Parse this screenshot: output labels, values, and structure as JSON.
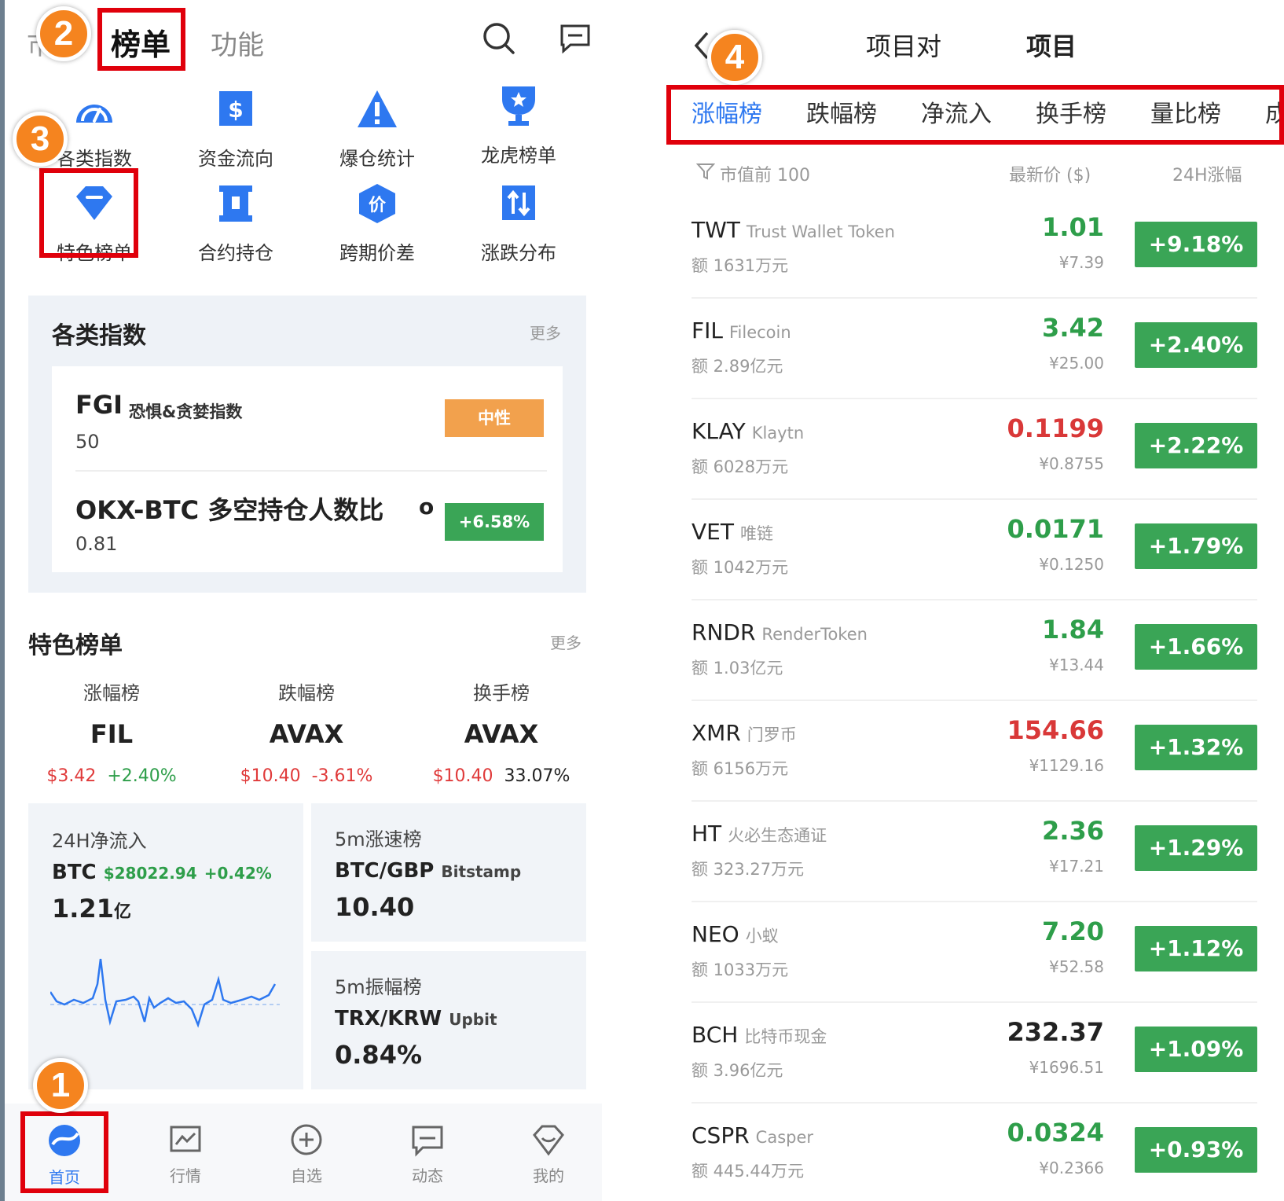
{
  "left": {
    "top_tabs": {
      "partial": "市",
      "rank": "榜单",
      "functions": "功能"
    },
    "functions": [
      {
        "label": "各类指数",
        "icon": "gauge-icon"
      },
      {
        "label": "资金流向",
        "icon": "dollar-icon"
      },
      {
        "label": "爆仓统计",
        "icon": "warning-icon"
      },
      {
        "label": "龙虎榜单",
        "icon": "trophy-icon"
      },
      {
        "label": "特色榜单",
        "icon": "diamond-icon"
      },
      {
        "label": "合约持仓",
        "icon": "contract-icon"
      },
      {
        "label": "跨期价差",
        "icon": "price-icon"
      },
      {
        "label": "涨跌分布",
        "icon": "updown-icon"
      }
    ],
    "index_section": {
      "title": "各类指数",
      "more": "更多",
      "fgi": {
        "code": "FGI",
        "name": "恐惧&贪婪指数",
        "value": "50",
        "badge": "中性",
        "badge_color": "#f2a14d"
      },
      "okx": {
        "name": "OKX-BTC 多空持仓人数比",
        "suffix": "o",
        "value": "0.81",
        "badge": "+6.58%",
        "badge_color": "#3aa556"
      }
    },
    "feature_section": {
      "title": "特色榜单",
      "more": "更多",
      "columns": [
        {
          "cat": "涨幅榜",
          "sym": "FIL",
          "price": "$3.42",
          "change": "+2.40%"
        },
        {
          "cat": "跌幅榜",
          "sym": "AVAX",
          "price": "$10.40",
          "change": "-3.61%"
        },
        {
          "cat": "换手榜",
          "sym": "AVAX",
          "price": "$10.40",
          "change": "33.07%"
        }
      ]
    },
    "cards": {
      "netflow": {
        "title": "24H净流入",
        "sym": "BTC",
        "price": "$28022.94",
        "change": "+0.42%",
        "value": "1.21",
        "unit": "亿"
      },
      "speed": {
        "title": "5m涨速榜",
        "pair": "BTC/GBP",
        "exchange": "Bitstamp",
        "value": "10.40"
      },
      "amp": {
        "title": "5m振幅榜",
        "pair": "TRX/KRW",
        "exchange": "Upbit",
        "value": "0.84%"
      }
    },
    "nav": [
      {
        "label": "首页",
        "icon": "home-icon"
      },
      {
        "label": "行情",
        "icon": "chart-icon"
      },
      {
        "label": "自选",
        "icon": "add-icon"
      },
      {
        "label": "动态",
        "icon": "message-icon"
      },
      {
        "label": "我的",
        "icon": "profile-icon"
      }
    ],
    "badges": [
      "1",
      "2",
      "3"
    ]
  },
  "right": {
    "header": {
      "tab1": "项目对",
      "tab2": "项目",
      "badge": "4"
    },
    "categories": [
      "涨幅榜",
      "跌幅榜",
      "净流入",
      "换手榜",
      "量比榜",
      "成"
    ],
    "filter": "市值前 100",
    "col_price": "最新价 ($)",
    "col_change": "24H涨幅",
    "rows": [
      {
        "sym": "TWT",
        "name": "Trust Wallet Token",
        "vol": "额 1631万元",
        "price": "1.01",
        "price_color": "green",
        "cny": "¥7.39",
        "change": "+9.18%"
      },
      {
        "sym": "FIL",
        "name": "Filecoin",
        "vol": "额 2.89亿元",
        "price": "3.42",
        "price_color": "green",
        "cny": "¥25.00",
        "change": "+2.40%"
      },
      {
        "sym": "KLAY",
        "name": "Klaytn",
        "vol": "额 6028万元",
        "price": "0.1199",
        "price_color": "red",
        "cny": "¥0.8755",
        "change": "+2.22%"
      },
      {
        "sym": "VET",
        "name": "唯链",
        "vol": "额 1042万元",
        "price": "0.0171",
        "price_color": "green",
        "cny": "¥0.1250",
        "change": "+1.79%"
      },
      {
        "sym": "RNDR",
        "name": "RenderToken",
        "vol": "额 1.03亿元",
        "price": "1.84",
        "price_color": "green",
        "cny": "¥13.44",
        "change": "+1.66%"
      },
      {
        "sym": "XMR",
        "name": "门罗币",
        "vol": "额 6156万元",
        "price": "154.66",
        "price_color": "red",
        "cny": "¥1129.16",
        "change": "+1.32%"
      },
      {
        "sym": "HT",
        "name": "火必生态通证",
        "vol": "额 323.27万元",
        "price": "2.36",
        "price_color": "green",
        "cny": "¥17.21",
        "change": "+1.29%"
      },
      {
        "sym": "NEO",
        "name": "小蚁",
        "vol": "额 1033万元",
        "price": "7.20",
        "price_color": "green",
        "cny": "¥52.58",
        "change": "+1.12%"
      },
      {
        "sym": "BCH",
        "name": "比特币现金",
        "vol": "额 3.96亿元",
        "price": "232.37",
        "price_color": "dark",
        "cny": "¥1696.51",
        "change": "+1.09%"
      },
      {
        "sym": "CSPR",
        "name": "Casper",
        "vol": "额 445.44万元",
        "price": "0.0324",
        "price_color": "green",
        "cny": "¥0.2366",
        "change": "+0.93%"
      }
    ]
  }
}
